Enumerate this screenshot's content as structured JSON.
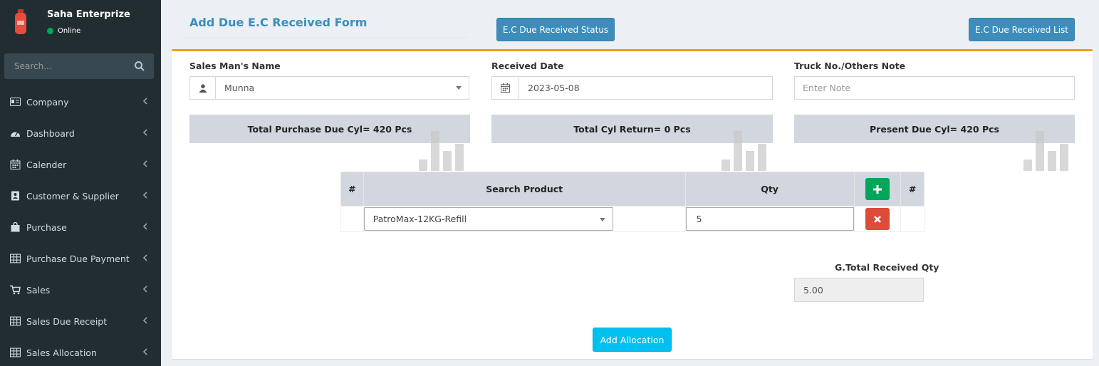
{
  "sidebar": {
    "brand": "Saha Enterprize",
    "status": "Online",
    "search_placeholder": "Search...",
    "items": [
      {
        "label": "Company",
        "icon": "id-card-icon"
      },
      {
        "label": "Dashboard",
        "icon": "dashboard-icon"
      },
      {
        "label": "Calender",
        "icon": "calendar-icon"
      },
      {
        "label": "Customer & Supplier",
        "icon": "contact-book-icon"
      },
      {
        "label": "Purchase",
        "icon": "shopping-bag-icon"
      },
      {
        "label": "Purchase Due Payment",
        "icon": "table-icon"
      },
      {
        "label": "Sales",
        "icon": "cart-icon"
      },
      {
        "label": "Sales Due Receipt",
        "icon": "table-icon"
      },
      {
        "label": "Sales Allocation",
        "icon": "table-icon"
      }
    ]
  },
  "header": {
    "title": "Add Due E.C Received Form",
    "status_button": "E.C Due Received Status",
    "list_button": "E.C Due Received List"
  },
  "form": {
    "salesman_label": "Sales Man's Name",
    "salesman_value": "Munna",
    "date_label": "Received Date",
    "date_value": "2023-05-08",
    "note_label": "Truck No./Others Note",
    "note_placeholder": "Enter Note"
  },
  "summary": {
    "purchase_due": "Total Purchase Due Cyl= 420 Pcs",
    "cyl_return": "Total Cyl Return= 0 Pcs",
    "present_due": "Present Due Cyl= 420 Pcs"
  },
  "table": {
    "headers": {
      "index": "#",
      "product": "Search Product",
      "qty": "Qty",
      "index2": "#"
    },
    "rows": [
      {
        "product": "PatroMax-12KG-Refill",
        "qty": "5"
      }
    ]
  },
  "totals": {
    "label": "G.Total Received Qty",
    "value": "5.00"
  },
  "actions": {
    "submit": "Add Allocation"
  },
  "colors": {
    "sidebar_bg": "#222d32",
    "accent_blue": "#3c8dbc",
    "box_border": "#f39c12",
    "add_green": "#00a65a",
    "remove_red": "#dd4b39",
    "submit_cyan": "#00c0ef"
  }
}
